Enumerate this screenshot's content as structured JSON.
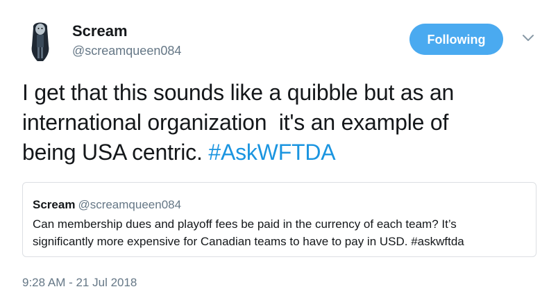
{
  "author": {
    "display_name": "Scream",
    "handle": "@screamqueen084",
    "avatar_icon": "character-avatar-icon"
  },
  "follow_button": {
    "label": "Following",
    "color": "#4aaaf0"
  },
  "menu_icon": "chevron-down-icon",
  "tweet": {
    "lines": [
      "I get that this sounds like a quibble but as an",
      "international organization  it's an example of",
      "being USA centric. "
    ],
    "hashtag": "#AskWFTDA",
    "hashtag_color": "#1b95e0"
  },
  "quoted_tweet": {
    "display_name": "Scream",
    "handle": "@screamqueen084",
    "lines": [
      "Can membership dues and playoff fees be paid in the currency of each team? It’s",
      "significantly more expensive for Canadian teams to have to pay in USD. #askwftda"
    ]
  },
  "timestamp": "9:28 AM - 21 Jul 2018"
}
